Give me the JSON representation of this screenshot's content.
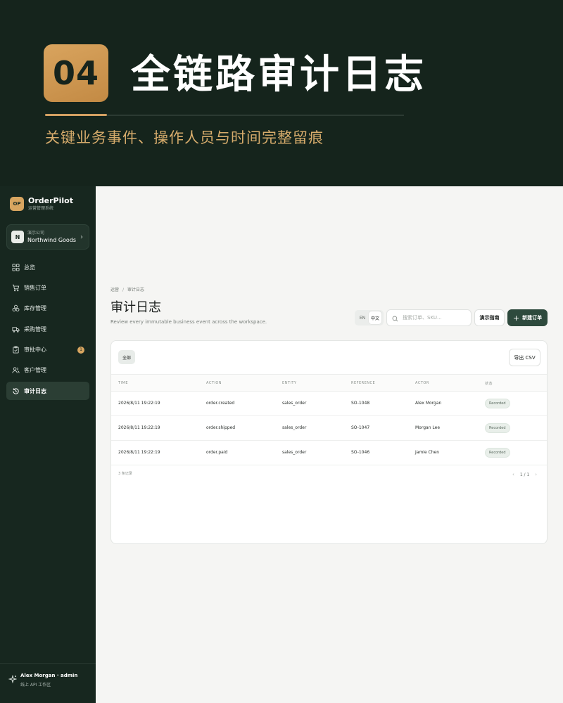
{
  "hero": {
    "badge": "04",
    "title": "全链路审计日志",
    "subtitle": "关键业务事件、操作人员与时间完整留痕"
  },
  "sidebar": {
    "brand": {
      "logo": "OP",
      "name": "OrderPilot",
      "subtitle": "运营管理系统"
    },
    "tenant": {
      "avatar": "N",
      "label": "演示公司",
      "name": "Northwind Goods",
      "icon": "chevron-right-icon"
    },
    "items": [
      {
        "label": "总览",
        "icon": "dashboard-grid-icon"
      },
      {
        "label": "销售订单",
        "icon": "cart-icon"
      },
      {
        "label": "库存管理",
        "icon": "boxes-icon"
      },
      {
        "label": "采购管理",
        "icon": "truck-icon"
      },
      {
        "label": "审批中心",
        "icon": "clipboard-icon",
        "badge": "1"
      },
      {
        "label": "客户管理",
        "icon": "users-icon"
      },
      {
        "label": "审计日志",
        "icon": "history-icon",
        "active": true
      }
    ],
    "footer": {
      "name": "Alex Morgan · admin",
      "subtitle": "线上 API 工作区",
      "icon": "sparkle-icon"
    }
  },
  "main": {
    "breadcrumb": [
      "运营",
      "审计日志"
    ],
    "breadcrumb_sep": "/",
    "title": "审计日志",
    "description": "Review every immutable business event across the workspace.",
    "lang": {
      "en": "EN",
      "zh": "中文",
      "selected": "中文"
    },
    "search": {
      "placeholder": "搜索订单、SKU...",
      "value": ""
    },
    "guide_button": "演示指南",
    "new_button": "新建订单",
    "new_button_icon": "+",
    "filter_chip": "全部",
    "export_button": "导出 CSV",
    "table": {
      "columns": [
        "TIME",
        "ACTION",
        "ENTITY",
        "REFERENCE",
        "ACTOR",
        "状态"
      ],
      "rows": [
        [
          "2026/8/11 19:22:19",
          "order.created",
          "sales_order",
          "SO-1048",
          "Alex Morgan",
          "Recorded"
        ],
        [
          "2026/8/11 19:22:19",
          "order.shipped",
          "sales_order",
          "SO-1047",
          "Morgan Lee",
          "Recorded"
        ],
        [
          "2026/8/11 19:22:19",
          "order.paid",
          "sales_order",
          "SO-1046",
          "Jamie Chen",
          "Recorded"
        ]
      ]
    },
    "record_count": "3 条记录",
    "pager": {
      "prev": "‹",
      "page": "1 / 1",
      "next": "›"
    }
  },
  "colors": {
    "dark_green": "#16241d",
    "gold": "#d8a560",
    "primary_button": "#2e4a3d"
  }
}
